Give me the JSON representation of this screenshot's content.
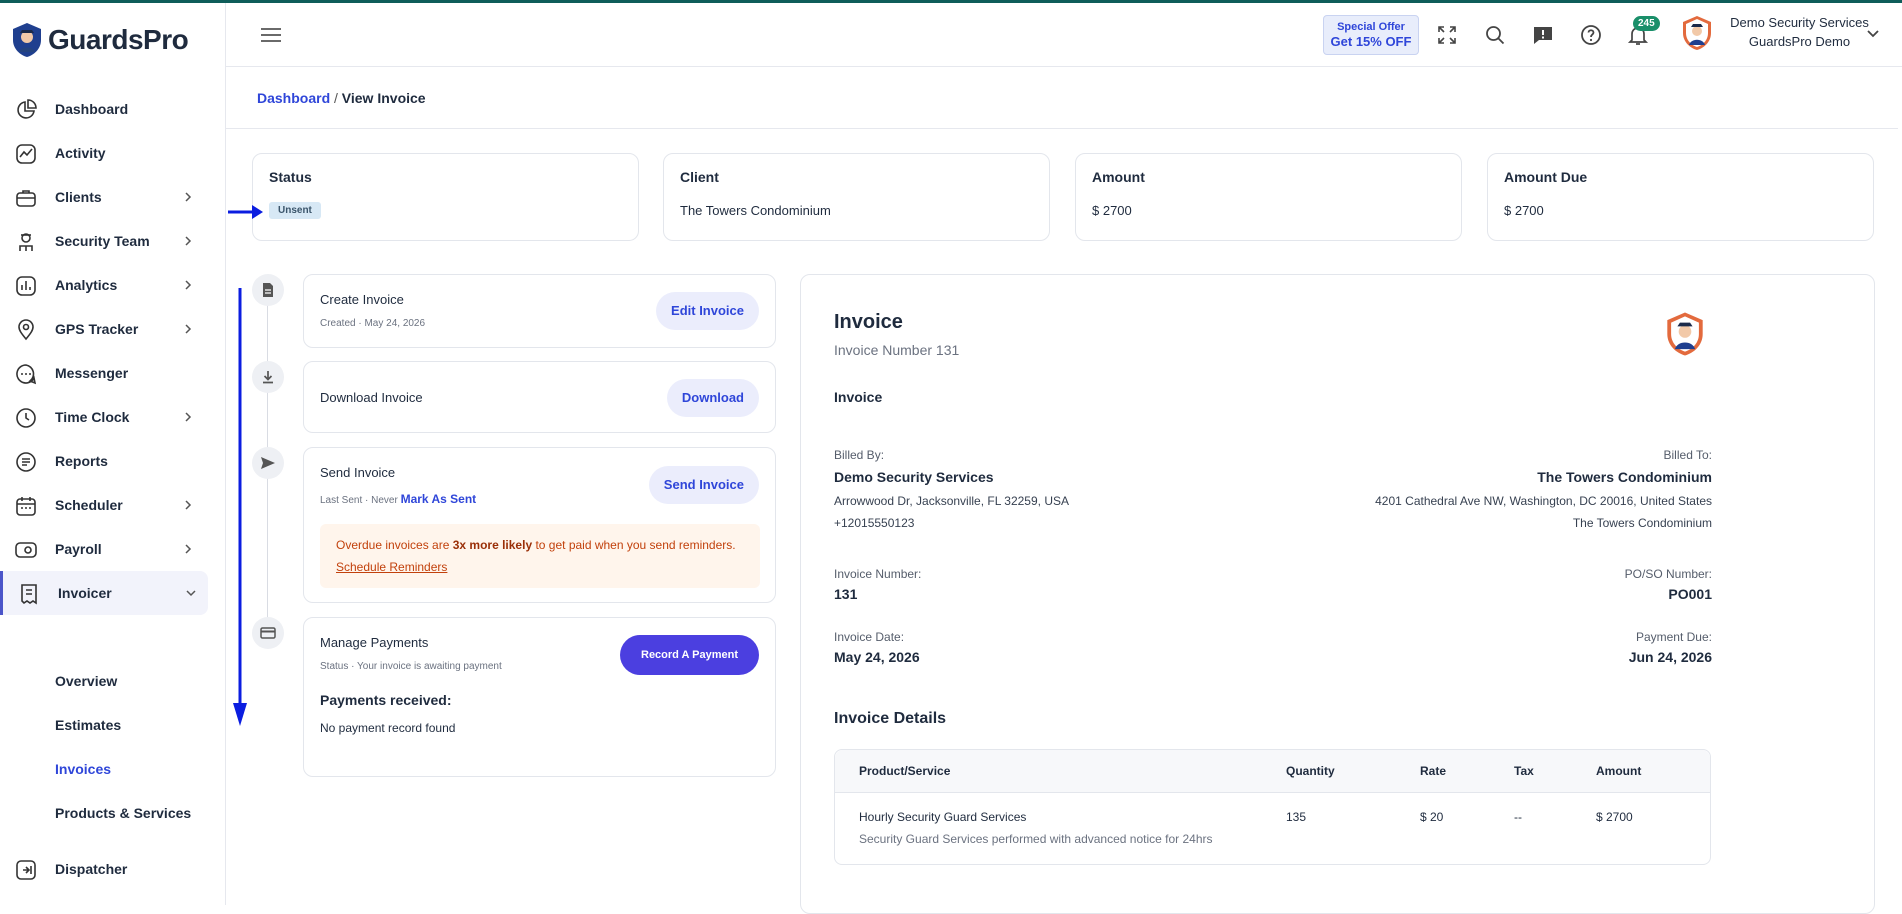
{
  "brand": {
    "name": "GuardsPro"
  },
  "sidebar": {
    "items": [
      {
        "label": "Dashboard",
        "icon": "pie-chart-icon",
        "chevron": false
      },
      {
        "label": "Activity",
        "icon": "activity-icon",
        "chevron": false
      },
      {
        "label": "Clients",
        "icon": "briefcase-icon",
        "chevron": true
      },
      {
        "label": "Security Team",
        "icon": "guard-icon",
        "chevron": true
      },
      {
        "label": "Analytics",
        "icon": "bar-chart-icon",
        "chevron": true
      },
      {
        "label": "GPS Tracker",
        "icon": "map-pin-icon",
        "chevron": true
      },
      {
        "label": "Messenger",
        "icon": "chat-icon",
        "chevron": false
      },
      {
        "label": "Time Clock",
        "icon": "clock-icon",
        "chevron": true
      },
      {
        "label": "Reports",
        "icon": "report-icon",
        "chevron": false
      },
      {
        "label": "Scheduler",
        "icon": "calendar-icon",
        "chevron": true
      },
      {
        "label": "Payroll",
        "icon": "payroll-icon",
        "chevron": true
      },
      {
        "label": "Invoicer",
        "icon": "invoice-icon",
        "chevron": true
      }
    ],
    "sub_items": [
      "Overview",
      "Estimates",
      "Invoices",
      "Products & Services"
    ],
    "dispatcher": "Dispatcher"
  },
  "topbar": {
    "offer_line1": "Special Offer",
    "offer_line2": "Get 15% OFF",
    "notification_count": "245",
    "user_name": "Demo Security Services",
    "user_org": "GuardsPro Demo"
  },
  "breadcrumb": {
    "root": "Dashboard",
    "separator": "/",
    "current": "View Invoice"
  },
  "stats": {
    "status_title": "Status",
    "status_value": "Unsent",
    "client_title": "Client",
    "client_value": "The Towers Condominium",
    "amount_title": "Amount",
    "amount_value": "$ 2700",
    "due_title": "Amount Due",
    "due_value": "$ 2700"
  },
  "steps": {
    "create_title": "Create Invoice",
    "create_sub": "Created · May 24, 2026",
    "create_btn": "Edit Invoice",
    "download_title": "Download Invoice",
    "download_btn": "Download",
    "send_title": "Send Invoice",
    "send_sub": "Last Sent · Never",
    "mark_sent": "Mark As Sent",
    "send_btn": "Send Invoice",
    "warn_pre": "Overdue invoices are ",
    "warn_bold": "3x more likely",
    "warn_post": " to get paid when you send reminders.",
    "warn_link": "Schedule Reminders",
    "pay_title": "Manage Payments",
    "pay_sub": "Status · Your invoice is awaiting payment",
    "pay_btn": "Record A Payment",
    "pay_received": "Payments received:",
    "pay_none": "No payment record found"
  },
  "invoice": {
    "heading": "Invoice",
    "number_line": "Invoice Number 131",
    "subheading": "Invoice",
    "billed_by_label": "Billed By:",
    "billed_by_name": "Demo Security Services",
    "billed_by_addr": "Arrowwood Dr, Jacksonville, FL 32259, USA",
    "billed_by_phone": "+12015550123",
    "billed_to_label": "Billed To:",
    "billed_to_name": "The Towers Condominium",
    "billed_to_addr": "4201 Cathedral Ave NW, Washington, DC 20016, United States",
    "billed_to_extra": "The Towers Condominium",
    "inv_number_label": "Invoice Number:",
    "inv_number": "131",
    "po_label": "PO/SO Number:",
    "po": "PO001",
    "date_label": "Invoice Date:",
    "date": "May 24, 2026",
    "due_label": "Payment Due:",
    "due": "Jun 24, 2026",
    "details_heading": "Invoice Details",
    "columns": [
      "Product/Service",
      "Quantity",
      "Rate",
      "Tax",
      "Amount"
    ],
    "rows": [
      {
        "product": "Hourly Security Guard Services",
        "description": "Security Guard Services performed with advanced notice for 24hrs",
        "quantity": "135",
        "rate": "$ 20",
        "tax": "--",
        "amount": "$ 2700"
      }
    ]
  },
  "colors": {
    "accent": "#2f46d9",
    "primary_button": "#4b3fe0",
    "warning": "#c2410c",
    "annotation": "#0b1de0"
  }
}
